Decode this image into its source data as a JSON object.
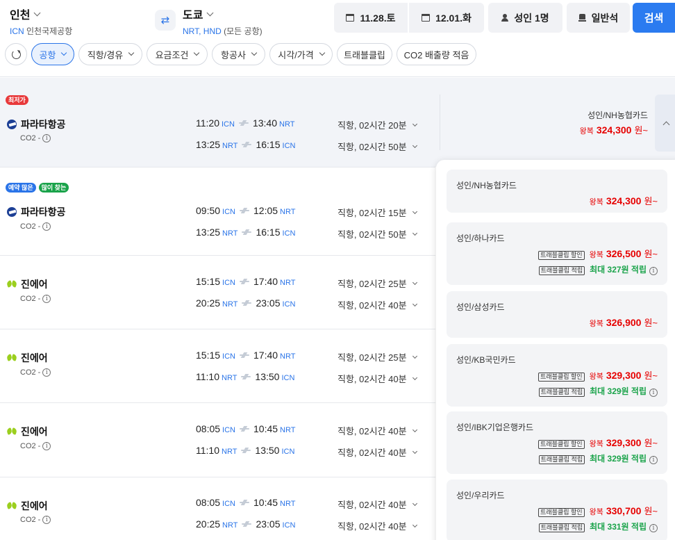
{
  "header": {
    "origin": {
      "city": "인천",
      "code": "ICN",
      "airport": "인천국제공항"
    },
    "swap_icon": "swap-arrows-icon",
    "destination": {
      "city": "도쿄",
      "code": "NRT, HND",
      "airport": "(모든 공항)"
    },
    "depart_date": "11.28.토",
    "return_date": "12.01.화",
    "passengers": "성인 1명",
    "cabin": "일반석",
    "search_label": "검색"
  },
  "filters": [
    {
      "label": "공항",
      "active": true
    },
    {
      "label": "직항/경유"
    },
    {
      "label": "요금조건"
    },
    {
      "label": "항공사"
    },
    {
      "label": "시각/가격"
    },
    {
      "label": "트래블클립"
    },
    {
      "label": "CO2 배출량 적음"
    }
  ],
  "results": [
    {
      "badges": [
        "최저가"
      ],
      "airline": "파라타항공",
      "co2": "CO2 -",
      "out": {
        "dep": "11:20",
        "dep_ap": "ICN",
        "arr": "13:40",
        "arr_ap": "NRT",
        "dur": "직항, 02시간 20분"
      },
      "ret": {
        "dep": "13:25",
        "dep_ap": "NRT",
        "arr": "16:15",
        "arr_ap": "ICN",
        "dur": "직항, 02시간 50분"
      }
    },
    {
      "badges": [
        "예약 많은",
        "많이 찾는"
      ],
      "airline": "파라타항공",
      "co2": "CO2 -",
      "out": {
        "dep": "09:50",
        "dep_ap": "ICN",
        "arr": "12:05",
        "arr_ap": "NRT",
        "dur": "직항, 02시간 15분"
      },
      "ret": {
        "dep": "13:25",
        "dep_ap": "NRT",
        "arr": "16:15",
        "arr_ap": "ICN",
        "dur": "직항, 02시간 50분"
      }
    },
    {
      "badges": [],
      "airline": "진에어",
      "co2": "CO2 -",
      "out": {
        "dep": "15:15",
        "dep_ap": "ICN",
        "arr": "17:40",
        "arr_ap": "NRT",
        "dur": "직항, 02시간 25분"
      },
      "ret": {
        "dep": "20:25",
        "dep_ap": "NRT",
        "arr": "23:05",
        "arr_ap": "ICN",
        "dur": "직항, 02시간 40분"
      }
    },
    {
      "badges": [],
      "airline": "진에어",
      "co2": "CO2 -",
      "out": {
        "dep": "15:15",
        "dep_ap": "ICN",
        "arr": "17:40",
        "arr_ap": "NRT",
        "dur": "직항, 02시간 25분"
      },
      "ret": {
        "dep": "11:10",
        "dep_ap": "NRT",
        "arr": "13:50",
        "arr_ap": "ICN",
        "dur": "직항, 02시간 40분"
      }
    },
    {
      "badges": [],
      "airline": "진에어",
      "co2": "CO2 -",
      "out": {
        "dep": "08:05",
        "dep_ap": "ICN",
        "arr": "10:45",
        "arr_ap": "NRT",
        "dur": "직항, 02시간 40분"
      },
      "ret": {
        "dep": "11:10",
        "dep_ap": "NRT",
        "arr": "13:50",
        "arr_ap": "ICN",
        "dur": "직항, 02시간 40분"
      }
    },
    {
      "badges": [],
      "airline": "진에어",
      "co2": "CO2 -",
      "out": {
        "dep": "08:05",
        "dep_ap": "ICN",
        "arr": "10:45",
        "arr_ap": "NRT",
        "dur": "직항, 02시간 40분"
      },
      "ret": {
        "dep": "20:25",
        "dep_ap": "NRT",
        "arr": "23:05",
        "arr_ap": "ICN",
        "dur": "직항, 02시간 40분"
      }
    }
  ],
  "selected_price": {
    "label": "성인/NH농협카드",
    "trip": "왕복",
    "amount": "324,300",
    "won": "원~"
  },
  "price_options": [
    {
      "label": "성인/NH농협카드",
      "trip": "왕복",
      "amount": "324,300",
      "won": "원~"
    },
    {
      "label": "성인/하나카드",
      "trip": "왕복",
      "amount": "326,500",
      "won": "원~",
      "tag_discount": "트래블클립 할인",
      "tag_earn": "트래블클립 적립",
      "earn": "최대 327원 적립"
    },
    {
      "label": "성인/삼성카드",
      "trip": "왕복",
      "amount": "326,900",
      "won": "원~"
    },
    {
      "label": "성인/KB국민카드",
      "trip": "왕복",
      "amount": "329,300",
      "won": "원~",
      "tag_discount": "트래블클립 할인",
      "tag_earn": "트래블클립 적립",
      "earn": "최대 329원 적립"
    },
    {
      "label": "성인/IBK기업은행카드",
      "trip": "왕복",
      "amount": "329,300",
      "won": "원~",
      "tag_discount": "트래블클립 할인",
      "tag_earn": "트래블클립 적립",
      "earn": "최대 329원 적립"
    },
    {
      "label": "성인/우리카드",
      "trip": "왕복",
      "amount": "330,700",
      "won": "원~",
      "tag_discount": "트래블클립 할인",
      "tag_earn": "트래블클립 적립",
      "earn": "최대 331원 적립"
    }
  ],
  "colors": {
    "accent": "#2b7bf0",
    "price": "#e60000",
    "earn": "#1aa34a",
    "badge_lowest": "#e8393b",
    "badge_booked": "#2a74e8",
    "badge_popular": "#1aa34a"
  }
}
